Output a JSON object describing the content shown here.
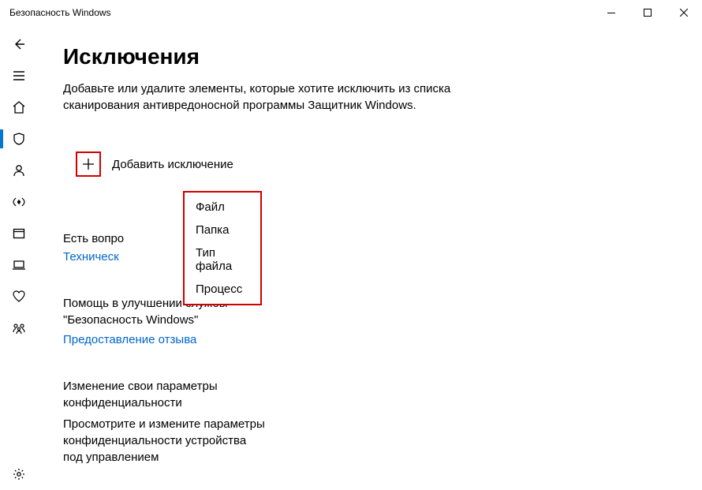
{
  "window": {
    "title": "Безопасность Windows"
  },
  "page": {
    "title": "Исключения",
    "description": "Добавьте или удалите элементы, которые хотите исключить из списка сканирования антивредоносной программы Защитник Windows."
  },
  "add_exclusion": {
    "label": "Добавить исключение",
    "options": [
      "Файл",
      "Папка",
      "Тип файла",
      "Процесс"
    ]
  },
  "questions": {
    "heading": "Есть вопро",
    "link": "Техническ"
  },
  "feedback": {
    "heading": "Помощь в улучшении службы \"Безопасность Windows\"",
    "link": "Предоставление отзыва"
  },
  "privacy": {
    "heading": "Изменение свои параметры конфиденциальности",
    "body": "Просмотрите и измените параметры конфиденциальности устройства под управлением"
  }
}
